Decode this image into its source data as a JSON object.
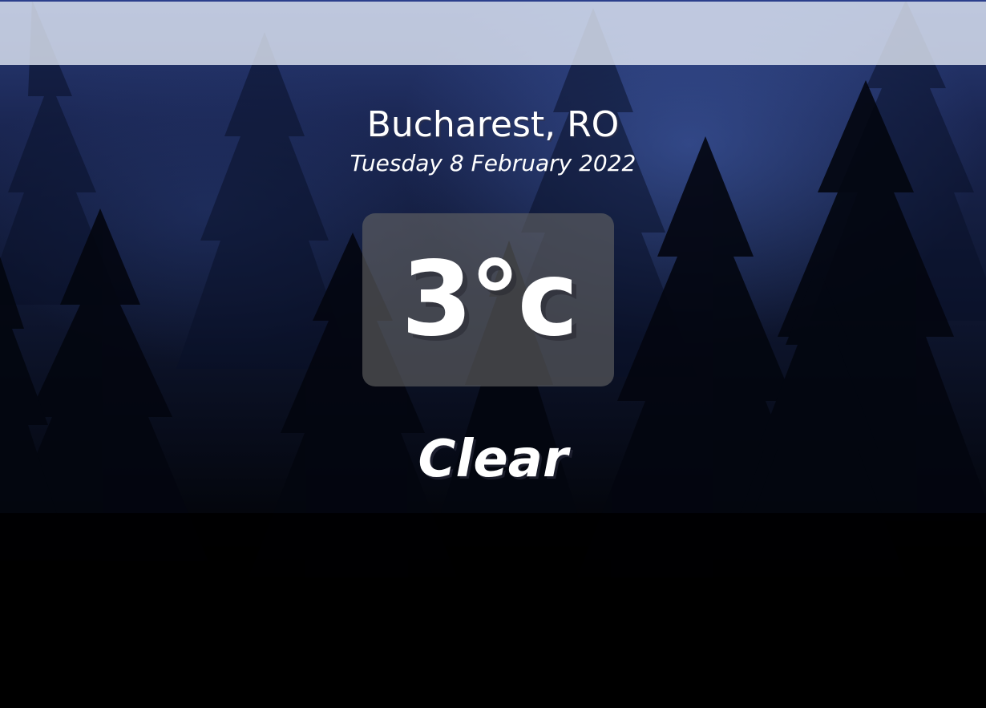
{
  "search": {
    "value": "",
    "placeholder": ""
  },
  "location": {
    "city_country": "Bucharest, RO",
    "date": "Tuesday 8 February 2022"
  },
  "weather": {
    "temperature": "3°c",
    "condition": "Clear"
  },
  "colors": {
    "search_bar_bg": "#e8eefa",
    "top_border": "#2b3f8c",
    "sky_top": "#2a3d7a",
    "bottom": "#000000",
    "text": "#ffffff",
    "temp_box_bg": "#646464"
  }
}
